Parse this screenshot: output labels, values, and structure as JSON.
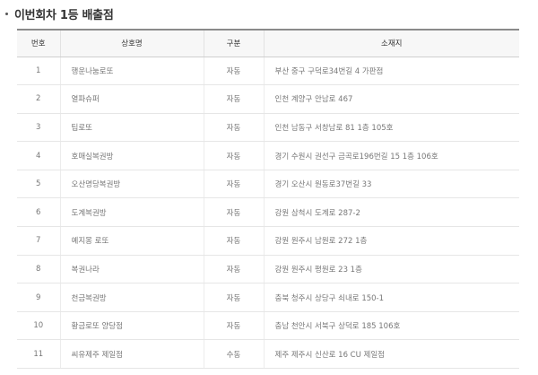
{
  "section": {
    "title": "이번회차 1등 배출점"
  },
  "table": {
    "headers": {
      "no": "번호",
      "name": "상호명",
      "type": "구분",
      "address": "소재지"
    },
    "rows": [
      {
        "no": "1",
        "name": "행운나눔로또",
        "type": "자동",
        "address": "부산 중구 구덕로34번길 4 가판점"
      },
      {
        "no": "2",
        "name": "열파슈퍼",
        "type": "자동",
        "address": "인천 계양구 안남로 467"
      },
      {
        "no": "3",
        "name": "팁로또",
        "type": "자동",
        "address": "인천 남동구 서창남로 81 1층 105호"
      },
      {
        "no": "4",
        "name": "호매실복권방",
        "type": "자동",
        "address": "경기 수원시 권선구 금곡로196번길 15 1층 106호"
      },
      {
        "no": "5",
        "name": "오산명당복권방",
        "type": "자동",
        "address": "경기 오산시 원동로37번길 33"
      },
      {
        "no": "6",
        "name": "도계복권방",
        "type": "자동",
        "address": "강원 삼척시 도계로 287-2"
      },
      {
        "no": "7",
        "name": "예지몽 로또",
        "type": "자동",
        "address": "강원 원주시 남원로 272 1층"
      },
      {
        "no": "8",
        "name": "복권나라",
        "type": "자동",
        "address": "강원 원주시 평원로 23 1층"
      },
      {
        "no": "9",
        "name": "천금복권방",
        "type": "자동",
        "address": "충북 청주시 상당구 쇠내로 150-1"
      },
      {
        "no": "10",
        "name": "황금로또 양당점",
        "type": "자동",
        "address": "충남 천안시 서북구 상덕로 185 106호"
      },
      {
        "no": "11",
        "name": "씨유제주 제일점",
        "type": "수동",
        "address": "제주 제주시 신산로 16 CU 제일점"
      }
    ]
  }
}
